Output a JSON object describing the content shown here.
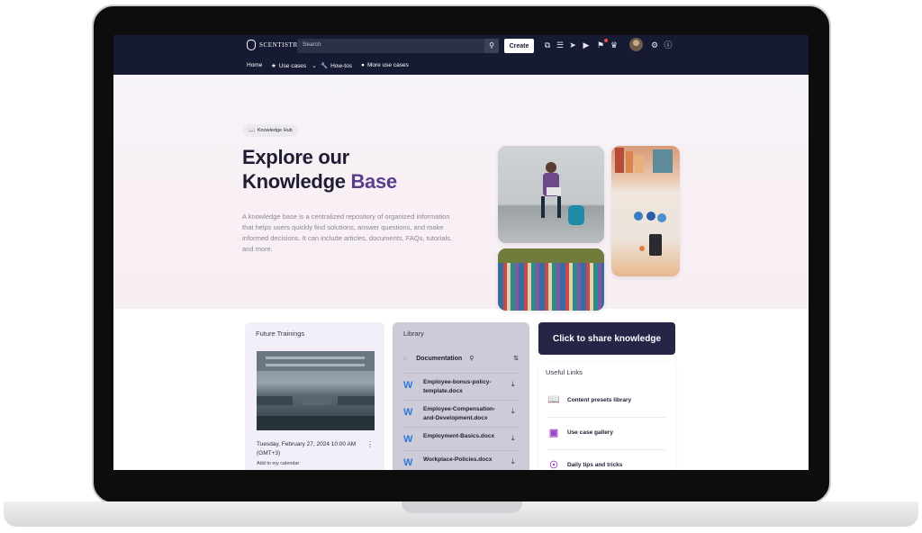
{
  "app": {
    "name": "SCENTISTRY"
  },
  "topbar": {
    "search_placeholder": "Search",
    "create_label": "Create",
    "icons": [
      "pages-icon",
      "list-icon",
      "megaphone-icon",
      "play-icon",
      "bell-icon",
      "trophy-icon",
      "gear-icon",
      "help-icon"
    ]
  },
  "nav": {
    "items": [
      {
        "label": "Home"
      },
      {
        "label": "Use cases"
      },
      {
        "label": "How-tos"
      },
      {
        "label": "More use cases"
      }
    ]
  },
  "hero": {
    "badge": "Knowledge Hub",
    "title_line1": "Explore our",
    "title_line2a": "Knowledge",
    "title_line2b": "Base",
    "description": "A knowledge base is a centralized repository of organized information that helps users quickly find solutions, answer questions, and make informed decisions. It can include articles, documents, FAQs, tutorials, and more."
  },
  "trainings": {
    "title": "Future Trainings",
    "date": "Tuesday, February 27, 2024 10:00 AM (GMT+3)",
    "calendar_link": "Add to my calendar"
  },
  "library": {
    "title": "Library",
    "folder": "Documentation",
    "files": [
      "Employee-bonus-policy-template.docx",
      "Employee-Compensation-and-Development.docx",
      "Employment-Basics.docx",
      "Workplace-Policies.docx"
    ]
  },
  "share_button": "Click to share knowledge",
  "useful_links": {
    "title": "Useful Links",
    "items": [
      "Content presets library",
      "Use case gallery",
      "Daily tips and tricks"
    ]
  },
  "colors": {
    "topbar": "#161a33",
    "accent": "#5a3e8c",
    "share_button": "#262548",
    "link_icon": "#9a45c8",
    "word_icon": "#2a78d9"
  }
}
